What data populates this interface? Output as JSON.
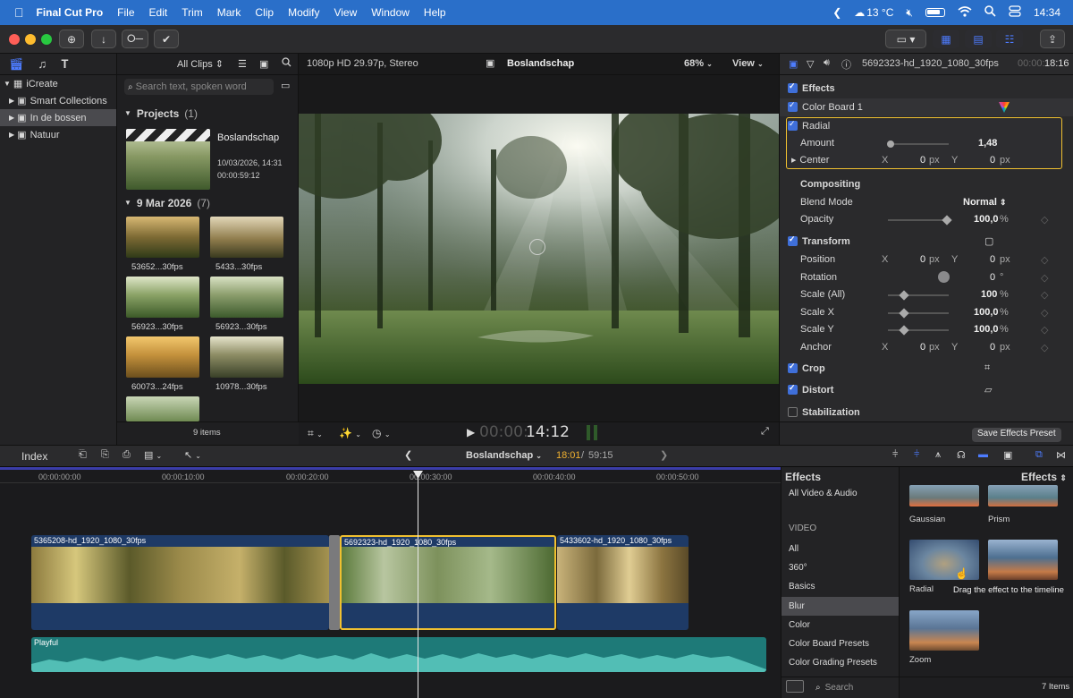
{
  "menubar": {
    "app": "Final Cut Pro",
    "items": [
      "File",
      "Edit",
      "Trim",
      "Mark",
      "Clip",
      "Modify",
      "View",
      "Window",
      "Help"
    ],
    "weather": "13 °C",
    "time": "14:34"
  },
  "library": {
    "root": "iCreate",
    "items": [
      {
        "label": "Smart Collections",
        "selected": false
      },
      {
        "label": "In de bossen",
        "selected": true
      },
      {
        "label": "Natuur",
        "selected": false
      }
    ]
  },
  "browser": {
    "filter": "All Clips",
    "search_placeholder": "Search text, spoken word",
    "projects_header": "Projects",
    "projects_count": "(1)",
    "project": {
      "name": "Boslandschap",
      "date": "10/03/2026, 14:31",
      "duration": "00:00:59:12"
    },
    "event_header": "9 Mar 2026",
    "event_count": "(7)",
    "clips": [
      "53652...30fps",
      "5433...30fps",
      "56923...30fps",
      "56923...30fps",
      "60073...24fps",
      "10978...30fps"
    ],
    "item_count": "9 items"
  },
  "viewer": {
    "format": "1080p HD 29.97p, Stereo",
    "project_title": "Boslandschap",
    "zoom": "68%",
    "view_menu": "View",
    "timecode_dim": "00:00:",
    "timecode": "14:12"
  },
  "inspector": {
    "clip_name": "5692323-hd_1920_1080_30fps",
    "duration_dim": "00:00:",
    "duration": "18:16",
    "effects_label": "Effects",
    "color_board": "Color Board 1",
    "radial": "Radial",
    "amount_label": "Amount",
    "amount_value": "1,48",
    "amount_level": 0.05,
    "center_label": "Center",
    "x_label": "X",
    "y_label": "Y",
    "zero": "0",
    "px": "px",
    "compositing": "Compositing",
    "blend_label": "Blend Mode",
    "blend_value": "Normal",
    "opacity_label": "Opacity",
    "opacity_value": "100,0",
    "percent": "%",
    "transform": "Transform",
    "position_label": "Position",
    "rotation_label": "Rotation",
    "rotation_value": "0",
    "degree": "°",
    "scale_all_label": "Scale (All)",
    "scale_all_value": "100",
    "scale_x_label": "Scale X",
    "scale_x_value": "100,0",
    "scale_y_label": "Scale Y",
    "scale_y_value": "100,0",
    "anchor_label": "Anchor",
    "crop": "Crop",
    "distort": "Distort",
    "stabilization": "Stabilization",
    "save_preset": "Save Effects Preset"
  },
  "timeline": {
    "index": "Index",
    "project": "Boslandschap",
    "position": "18:01",
    "total": "59:15",
    "ticks": [
      "00:00:00:00",
      "00:00:10:00",
      "00:00:20:00",
      "00:00:30:00",
      "00:00:40:00",
      "00:00:50:00"
    ],
    "clips": [
      {
        "name": "5365208-hd_1920_1080_30fps"
      },
      {
        "name": "5692323-hd_1920_1080_30fps"
      },
      {
        "name": "5433602-hd_1920_1080_30fps"
      }
    ],
    "audio": "Playful"
  },
  "effects": {
    "header": "Effects",
    "menu": "Effects",
    "categories": [
      "All Video & Audio",
      "VIDEO",
      "All",
      "360°",
      "Basics",
      "Blur",
      "Color",
      "Color Board Presets",
      "Color Grading Presets"
    ],
    "selected_category": "Blur",
    "thumbs": [
      "Gaussian",
      "Prism",
      "Radial",
      "Zoom"
    ],
    "tooltip": "Drag the effect to the timeline",
    "search_placeholder": "Search",
    "count": "7 Items"
  },
  "colors": {
    "menubar": "#2a6fc9",
    "accent": "#3f6fd9",
    "selection": "#f0c030",
    "video_track": "#1e3a66",
    "audio_track": "#1e7a78"
  }
}
